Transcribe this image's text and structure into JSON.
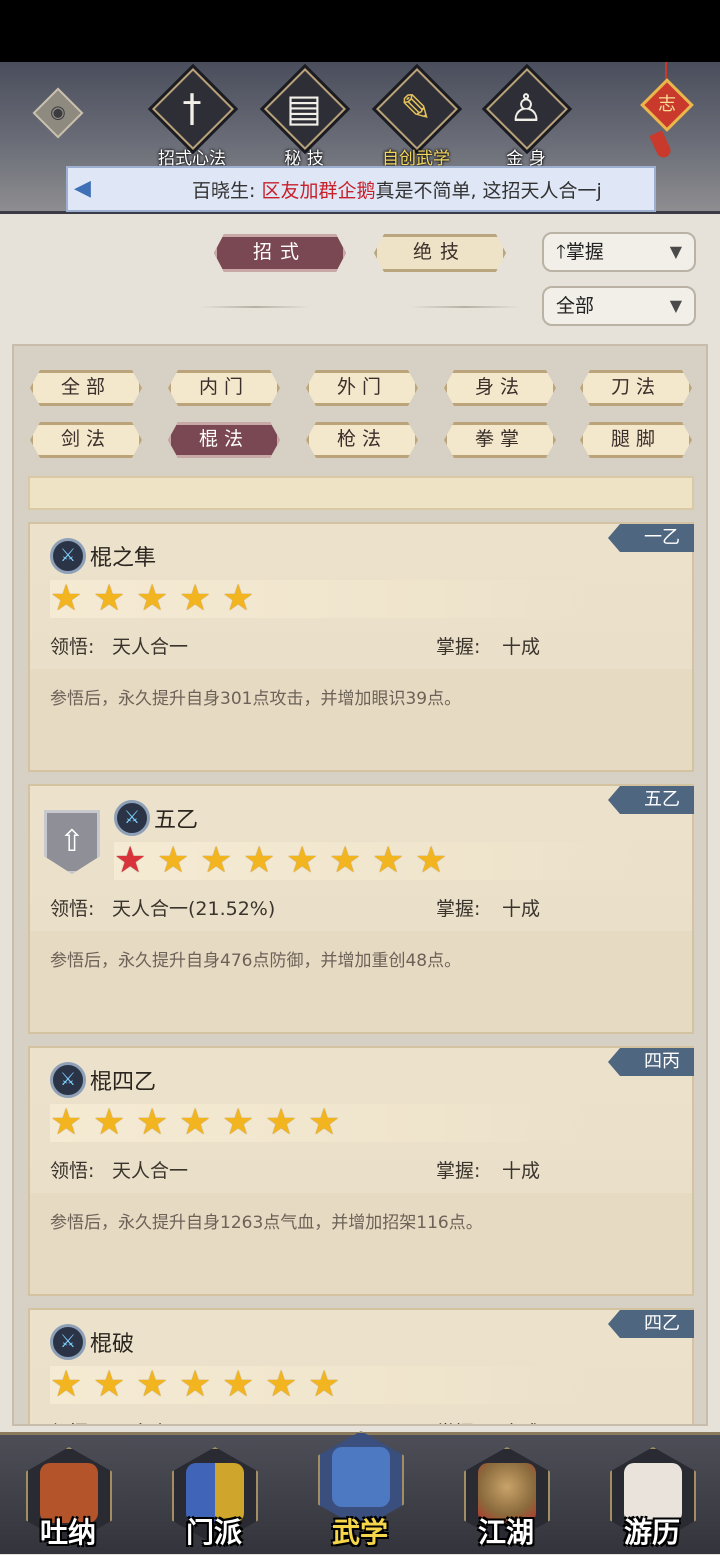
{
  "header": {
    "tabs": [
      {
        "label": "招式心法",
        "icon": "sword-icon",
        "glyph": "†"
      },
      {
        "label": "秘 技",
        "icon": "book-icon",
        "glyph": "▤"
      },
      {
        "label": "自创武学",
        "icon": "scroll-icon",
        "glyph": "✎"
      },
      {
        "label": "金 身",
        "icon": "meditation-icon",
        "glyph": "♙"
      }
    ],
    "eye_glyph": "◉",
    "ornament_text": "志",
    "marquee": {
      "speaker": "百晓生: ",
      "highlight": "区友加群企鹅",
      "rest": "真是不简单, 这招天人合一j"
    }
  },
  "filters": {
    "tab_moves": "招式",
    "tab_ultimate": "绝技",
    "sort_label": "掌握",
    "sort_arrow": "🡑",
    "scope_label": "全部",
    "chevron": "▼"
  },
  "categories": {
    "row1": [
      "全部",
      "内门",
      "外门",
      "身法",
      "刀法"
    ],
    "row2": [
      "剑法",
      "棍法",
      "枪法",
      "拳掌",
      "腿脚"
    ],
    "selected": "棍法"
  },
  "cards": [
    {
      "name": "棍之隼",
      "tag": "一乙",
      "stars": 5,
      "red_stars": 0,
      "insight_label": "领悟:",
      "insight_value": "天人合一",
      "mastery_label": "掌握:",
      "mastery_value": "十成",
      "description": "参悟后，永久提升自身301点攻击，并增加眼识39点。",
      "upgrade": false
    },
    {
      "name": "五乙",
      "tag": "五乙",
      "stars": 8,
      "red_stars": 1,
      "insight_label": "领悟:",
      "insight_value": "天人合一(21.52%)",
      "mastery_label": "掌握:",
      "mastery_value": "十成",
      "description": "参悟后，永久提升自身476点防御，并增加重创48点。",
      "upgrade": true
    },
    {
      "name": "棍四乙",
      "tag": "四丙",
      "stars": 7,
      "red_stars": 0,
      "insight_label": "领悟:",
      "insight_value": "天人合一",
      "mastery_label": "掌握:",
      "mastery_value": "十成",
      "description": "参悟后，永久提升自身1263点气血，并增加招架116点。",
      "upgrade": false
    },
    {
      "name": "棍破",
      "tag": "四乙",
      "stars": 7,
      "red_stars": 0,
      "insight_label": "领悟:",
      "insight_value": "天人合一",
      "mastery_label": "掌握:",
      "mastery_value": "十成",
      "description": "",
      "upgrade": false
    }
  ],
  "bottom_nav": [
    {
      "label": "吐纳",
      "icon": "monk-icon",
      "color": "#b4542a"
    },
    {
      "label": "门派",
      "icon": "banners-icon",
      "color": "#d0a52b"
    },
    {
      "label": "武学",
      "icon": "manual-icon",
      "color": "#4d78c2"
    },
    {
      "label": "江湖",
      "icon": "straw-hat-icon",
      "color": "#a07a4a"
    },
    {
      "label": "游历",
      "icon": "horse-icon",
      "color": "#e9e3dc"
    }
  ],
  "star_glyph": "★",
  "upgrade_glyph": "⇧",
  "skill_glyph": "⚔",
  "megaphone_glyph": "◀"
}
